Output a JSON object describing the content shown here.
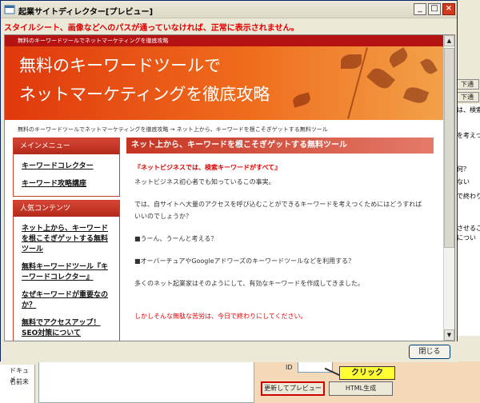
{
  "dialog": {
    "title": "起業サイトディレクター[プレビュー]",
    "warning": "スタイルシート、画像などへのパスが通っていなければ、正常に表示されません。",
    "close_button": "閉じる"
  },
  "site": {
    "topbar": "無料のキーワードツールでネットマーケティングを徹底攻略",
    "header_line1": "無料のキーワードツールで",
    "header_line2": "ネットマーケティングを徹底攻略",
    "breadcrumb": "無料のキーワードツールでネットマーケティングを徹底攻略 → ネット上から、キーワードを根こそぎゲットする無料ツール",
    "menu": {
      "title": "メインメニュー",
      "items": [
        "キーワードコレクター",
        "キーワード攻略講座"
      ]
    },
    "popular": {
      "title": "人気コンテンツ",
      "items": [
        "ネット上から、キーワードを根こそぎゲットする無料ツール",
        "無料キーワードツール『キーワードコレクター』",
        "なぜキーワードが重要なのか？",
        "無料でアクセスアップ！SEO対策について"
      ]
    },
    "article": {
      "heading": "ネット上から、キーワードを根こそぎゲットする無料ツール",
      "lead": "『ネットビジネスでは、検索キーワードがすべて』",
      "p1": "ネットビジネス初心者でも知っているこの事実。",
      "p2a": "では、自サイトへ大量のアクセスを呼び込むことができるキーワードを考えつくためにはどうすれば",
      "p2b": "いいのでしょうか？",
      "p3": "■うーん、うーんと考える？",
      "p4": "■オーバーチュアやGoogleアドワーズのキーワードツールなどを利用する？",
      "p5": "多くのネット起業家はそのようにして、有効なキーワードを作成してきました。",
      "p6": "しかしそんな無駄な苦労は、今日で終わりにしてください。"
    }
  },
  "background": {
    "right_btn1": "下通",
    "right_btn2": "下通",
    "right_lines": [
      "は、検索",
      "を考えつくた",
      "何？",
      "ない",
      "で終わり",
      "させること",
      "につい"
    ],
    "left_items": [
      "ドキュメ",
      "名前未"
    ],
    "id_label": "ID",
    "callout": "クリック",
    "preview_button": "更新してプレビュー",
    "html_button": "HTML生成"
  }
}
